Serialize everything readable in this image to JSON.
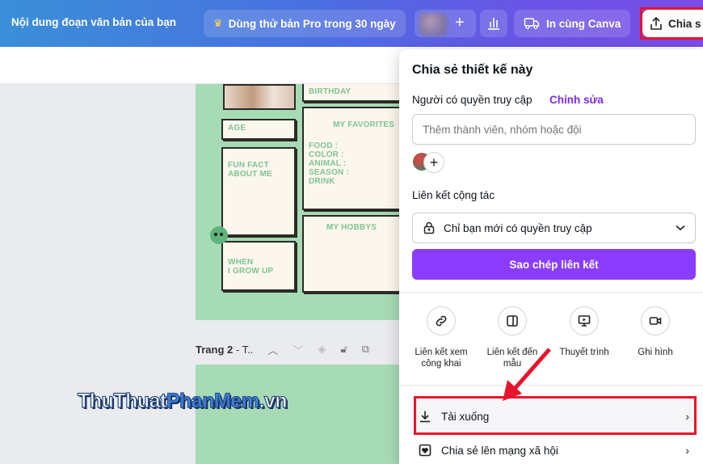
{
  "topbar": {
    "title": "Nội dung đoạn văn bản của bạn",
    "pro_label": "Dùng thử bản Pro trong 30 ngày",
    "print_label": "In cùng Canva",
    "share_label": "Chia s"
  },
  "canvas": {
    "card_birthday": "BIRTHDAY",
    "card_age": "AGE",
    "card_fun_fact": "FUN FACT\nABOUT ME",
    "card_favorites_title": "MY FAVORITES",
    "card_favorites_items": "FOOD :\nCOLOR :\nANIMAL :\nSEASON :\nDRINK",
    "card_when": "WHEN\nI GROW UP",
    "card_hobbys": "MY HOBBYS",
    "page_label_bold": "Trang 2",
    "page_label_rest": " - T.."
  },
  "watermark": {
    "part1": "ThuThuat",
    "part2": "PhanMem",
    "part3": ".vn"
  },
  "share_panel": {
    "title": "Chia sẻ thiết kế này",
    "access_label": "Người có quyền truy cập",
    "access_link": "Chỉnh sửa",
    "member_placeholder": "Thêm thành viên, nhóm hoặc đội",
    "collab_label": "Liên kết cộng tác",
    "access_select": "Chỉ bạn mới có quyền truy cập",
    "copy_button": "Sao chép liên kết",
    "options": [
      {
        "label": "Liên kết xem công khai",
        "icon": "link-icon"
      },
      {
        "label": "Liên kết đến mẫu",
        "icon": "template-icon"
      },
      {
        "label": "Thuyết trình",
        "icon": "present-icon"
      },
      {
        "label": "Ghi hình",
        "icon": "record-icon"
      }
    ],
    "download_label": "Tải xuống",
    "social_label": "Chia sẻ lên mạng xã hội"
  },
  "colors": {
    "accent_purple": "#8b3dff",
    "highlight_red": "#e8142c",
    "canvas_green": "#a7dbb5"
  }
}
